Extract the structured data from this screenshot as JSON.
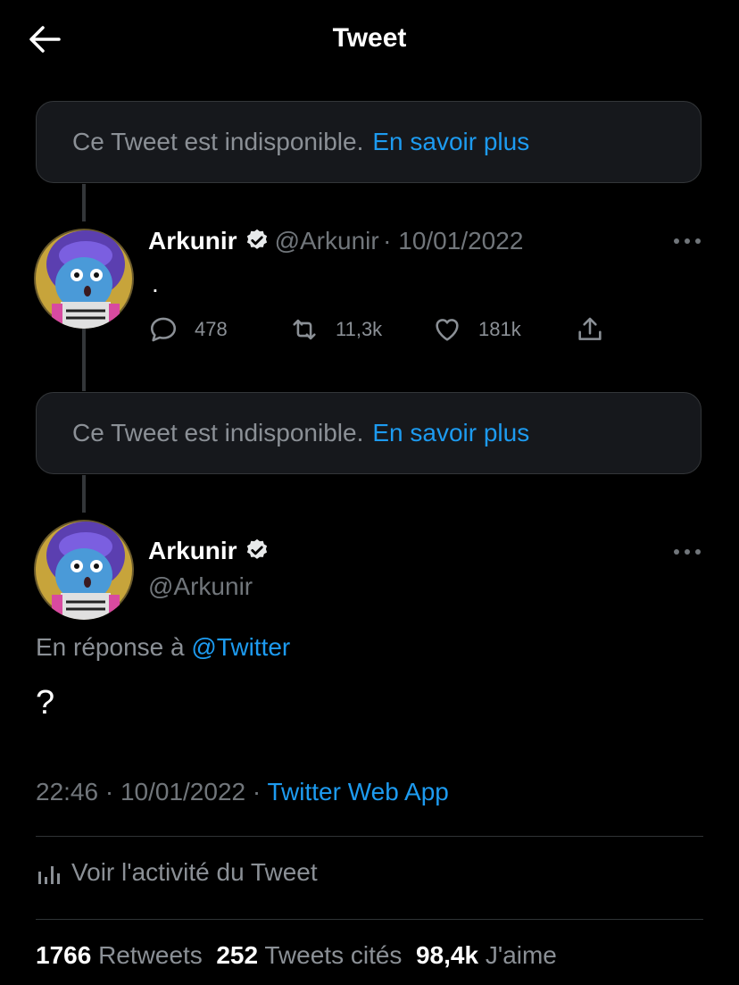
{
  "header": {
    "title": "Tweet"
  },
  "unavailable": {
    "text": "Ce Tweet est indisponible.",
    "link": "En savoir plus"
  },
  "tweet1": {
    "name": "Arkunir",
    "handle": "@Arkunir",
    "date": "· 10/01/2022",
    "text": ".",
    "replies": "478",
    "retweets": "11,3k",
    "likes": "181k"
  },
  "main": {
    "name": "Arkunir",
    "handle": "@Arkunir",
    "reply_prefix": "En réponse à",
    "reply_to": "@Twitter",
    "text": "?",
    "time": "22:46 · 10/01/2022 ·",
    "source": "Twitter Web App",
    "activity": "Voir l'activité du Tweet",
    "stats": {
      "retweets_count": "1766",
      "retweets_label": "Retweets",
      "quotes_count": "252",
      "quotes_label": "Tweets cités",
      "likes_count": "98,4k",
      "likes_label": "J'aime"
    }
  },
  "colors": {
    "accent": "#1d9bf0",
    "background": "#000000",
    "box": "#16181c"
  }
}
